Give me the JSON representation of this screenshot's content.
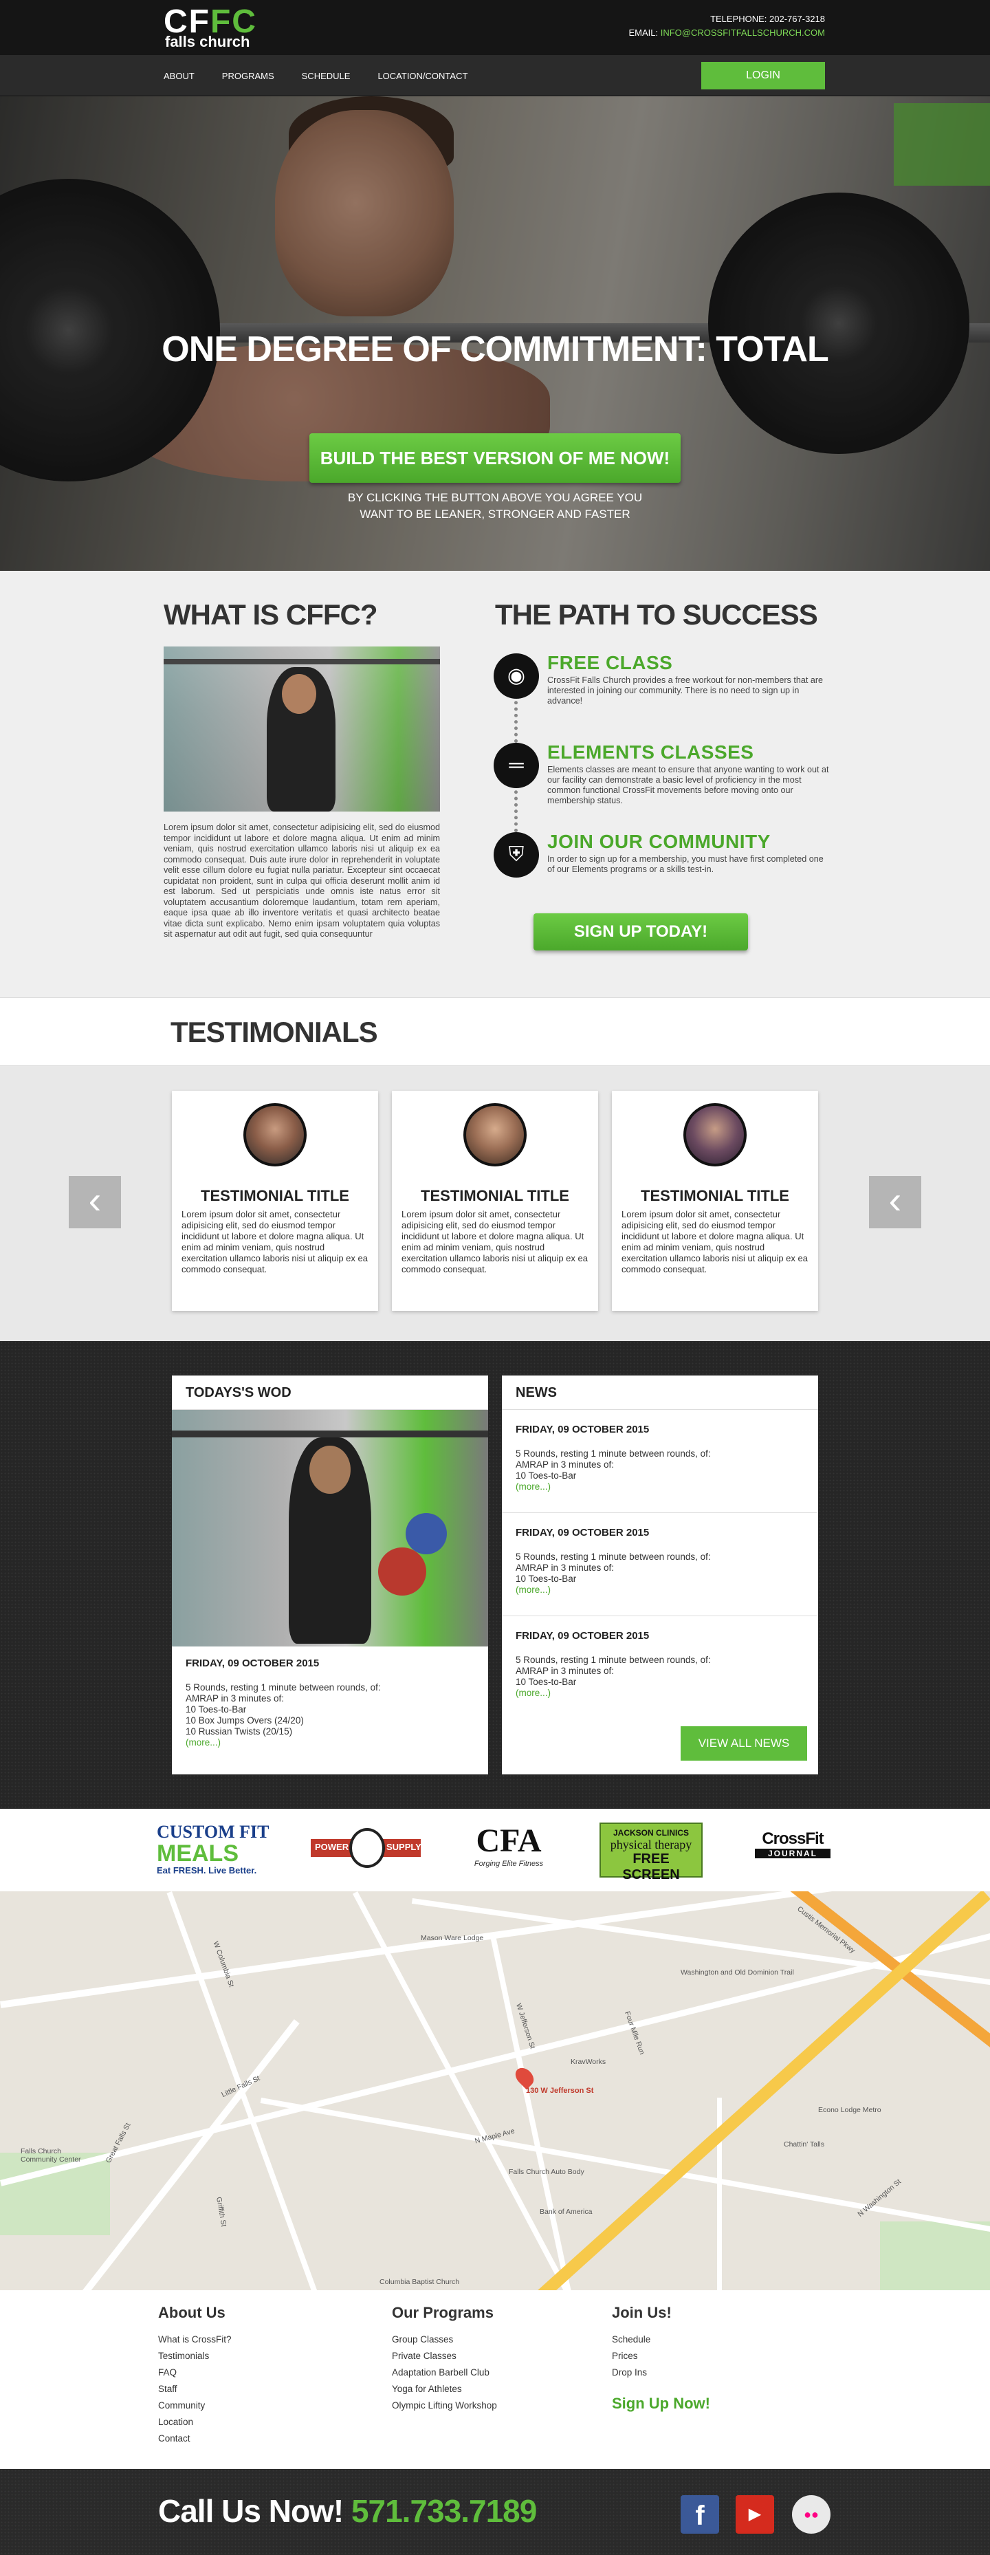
{
  "brand": {
    "logo_main_1": "CF",
    "logo_main_2": "FC",
    "logo_sub": "falls church"
  },
  "contact": {
    "telephone": "TELEPHONE: 202-767-3218",
    "email_label": "EMAIL:",
    "email": "INFO@CROSSFITFALLSCHURCH.COM"
  },
  "nav": {
    "items": [
      "ABOUT",
      "PROGRAMS",
      "SCHEDULE",
      "LOCATION/CONTACT"
    ],
    "login": "LOGIN"
  },
  "hero": {
    "title": "ONE DEGREE OF COMMITMENT: TOTAL",
    "button": "BUILD THE BEST VERSION OF ME NOW!",
    "note_line1": "BY CLICKING THE BUTTON ABOVE YOU AGREE YOU",
    "note_line2": "WANT TO BE LEANER, STRONGER AND FASTER"
  },
  "cffc": {
    "title": "WHAT IS CFFC?",
    "text": "Lorem ipsum dolor sit amet, consectetur adipisicing elit, sed do eiusmod tempor incididunt ut labore et dolore magna aliqua. Ut enim ad minim veniam, quis nostrud exercitation ullamco laboris nisi ut aliquip ex ea commodo consequat. Duis aute irure dolor in reprehenderit in voluptate velit esse cillum dolore eu fugiat nulla pariatur. Excepteur sint occaecat cupidatat non proident, sunt in culpa qui officia deserunt mollit anim id est laborum. Sed ut perspiciatis unde omnis iste natus error sit voluptatem accusantium doloremque laudantium, totam rem aperiam, eaque ipsa quae ab illo inventore veritatis et quasi architecto beatae vitae dicta sunt explicabo. Nemo enim ipsam voluptatem quia voluptas sit aspernatur aut odit aut fugit, sed quia consequuntur"
  },
  "path": {
    "title": "THE PATH TO SUCCESS",
    "steps": [
      {
        "title": "FREE CLASS",
        "text": "CrossFit Falls Church provides a free workout for non-members that are interested in joining our community.  There is no need to sign up in advance!"
      },
      {
        "title": "ELEMENTS CLASSES",
        "text": "Elements classes are meant to ensure that anyone wanting to work out at our facility can demonstrate a basic level of proficiency in the most common functional CrossFit movements before moving onto our membership status."
      },
      {
        "title": "JOIN OUR COMMUNITY",
        "text": "In order to sign up for a membership, you must have first completed one of our Elements programs or a skills test-in."
      }
    ],
    "button": "SIGN UP TODAY!"
  },
  "testimonials": {
    "title": "TESTIMONIALS",
    "prev": "‹",
    "next": "‹",
    "cards": [
      {
        "title": "TESTIMONIAL TITLE",
        "text": "Lorem ipsum dolor sit amet, consectetur adipisicing elit, sed do eiusmod tempor incididunt ut labore et dolore magna aliqua. Ut enim ad minim veniam, quis nostrud exercitation ullamco laboris nisi ut aliquip ex ea commodo consequat."
      },
      {
        "title": "TESTIMONIAL TITLE",
        "text": "Lorem ipsum dolor sit amet, consectetur adipisicing elit, sed do eiusmod tempor incididunt ut labore et dolore magna aliqua. Ut enim ad minim veniam, quis nostrud exercitation ullamco laboris nisi ut aliquip ex ea commodo consequat."
      },
      {
        "title": "TESTIMONIAL TITLE",
        "text": "Lorem ipsum dolor sit amet, consectetur adipisicing elit, sed do eiusmod tempor incididunt ut labore et dolore magna aliqua. Ut enim ad minim veniam, quis nostrud exercitation ullamco laboris nisi ut aliquip ex ea commodo consequat."
      }
    ]
  },
  "wod": {
    "title": "TODAYS'S WOD",
    "date": "FRIDAY, 09 OCTOBER 2015",
    "lines": [
      "5 Rounds, resting 1 minute between rounds, of:",
      "AMRAP in 3 minutes of:",
      "10 Toes-to-Bar",
      "10 Box Jumps Overs (24/20)",
      "10 Russian Twists (20/15)"
    ],
    "more": "(more...)"
  },
  "news": {
    "title": "NEWS",
    "items": [
      {
        "date": "FRIDAY, 09 OCTOBER 2015",
        "l1": "5 Rounds, resting 1 minute between rounds, of:",
        "l2": "AMRAP in 3 minutes of:",
        "l3": "10 Toes-to-Bar",
        "more": "(more...)"
      },
      {
        "date": "FRIDAY, 09 OCTOBER 2015",
        "l1": "5 Rounds, resting 1 minute between rounds, of:",
        "l2": "AMRAP in 3 minutes of:",
        "l3": "10 Toes-to-Bar",
        "more": "(more...)"
      },
      {
        "date": "FRIDAY, 09 OCTOBER 2015",
        "l1": "5 Rounds, resting 1 minute between rounds, of:",
        "l2": "AMRAP in 3 minutes of:",
        "l3": "10 Toes-to-Bar",
        "more": "(more...)"
      }
    ],
    "view_all": "VIEW ALL NEWS"
  },
  "sponsors": {
    "custom_fit_1": "CUSTOM FIT",
    "custom_fit_2": "MEALS",
    "custom_fit_3": "Eat FRESH. Live Better.",
    "power_supply_1": "POWER",
    "power_supply_2": "SUPPLY",
    "cfa_1": "CFA",
    "cfa_2": "Forging Elite Fitness",
    "jackson_1": "JACKSON CLINICS",
    "jackson_2": "physical therapy",
    "jackson_3": "FREE SCREEN",
    "crossfit_1": "CrossFit",
    "crossfit_2": "JOURNAL"
  },
  "map": {
    "pin_label": "130 W Jefferson St",
    "labels": [
      "Mason Ware Lodge",
      "Washington and Old Dominion Trail",
      "Four Mile Run",
      "KravWorks",
      "Econo Lodge Metro",
      "Chattin' Talls",
      "Falls Church Community Center",
      "Falls Church Auto Body",
      "Bank of America",
      "Columbia Baptist Church",
      "Little Falls St",
      "Great Falls St",
      "W Jefferson St",
      "N Maple Ave",
      "W Columbia St",
      "Custis Memorial Pkwy",
      "Griffith St",
      "N Washington St"
    ]
  },
  "footer": {
    "about": {
      "title": "About Us",
      "links": [
        "What is CrossFit?",
        "Testimonials",
        "FAQ",
        "Staff",
        "Community",
        "Location",
        "Contact"
      ]
    },
    "programs": {
      "title": "Our Programs",
      "links": [
        "Group Classes",
        "Private Classes",
        "Adaptation Barbell Club",
        "Yoga for Athletes",
        "Olympic Lifting Workshop"
      ]
    },
    "join": {
      "title": "Join Us!",
      "links": [
        "Schedule",
        "Prices",
        "Drop Ins"
      ],
      "signup": "Sign Up Now!"
    }
  },
  "callbar": {
    "label": "Call Us Now!",
    "number": "571.733.7189"
  },
  "social": {
    "facebook": "f",
    "youtube": "▶",
    "flickr": "●●"
  },
  "colors": {
    "accent": "#5fbd3c",
    "dark": "#151515",
    "nav": "#2b2b2b"
  }
}
